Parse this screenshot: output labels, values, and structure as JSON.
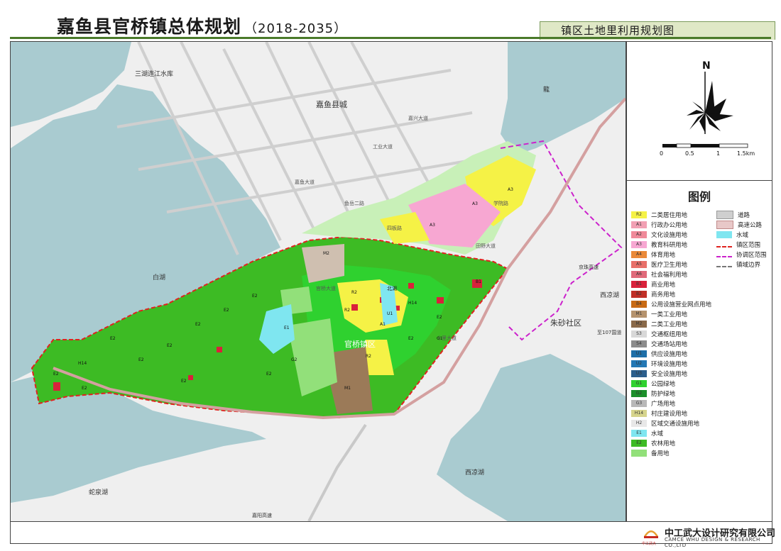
{
  "header": {
    "title": "嘉鱼县官桥镇总体规划",
    "years": "（2018-2035）",
    "subtitle": "镇区土地里利用规划图"
  },
  "colors": {
    "frame_green": "#4a7a2a",
    "water": "#a9cbd0",
    "farmland": "#3dbb24",
    "residential": "#f5f246",
    "education": "#f7a7d2",
    "commercial": "#d9213b",
    "industrial2": "#9b7a58",
    "reserve": "#92e07a",
    "area_boundary": "#e0221f",
    "coord_boundary": "#cc22cc"
  },
  "map": {
    "place_labels": {
      "reservoir": "三湖连江水库",
      "county_town": "嘉鱼县城",
      "bai_lake": "白湖",
      "town_center": "官桥镇区",
      "zhusha": "朱砂社区",
      "xiliang_lake1": "西凉湖",
      "xiliang_lake2": "西凉湖",
      "sheqian_lake": "蛇泉湖",
      "long": "龍",
      "north_lake": "北湖",
      "national_road": "京珠高速",
      "road_107": "至107国道",
      "road_bottom": "嘉阳高速"
    },
    "road_labels": {
      "r1": "嘉鱼大道",
      "r2": "工业大道",
      "r3": "嘉兴大道",
      "r4": "田野大道",
      "r5": "学院路",
      "r6": "官桥大道",
      "r7": "十里大道",
      "r8": "鱼岳二路",
      "r9": "四板路"
    },
    "parcel_codes": [
      "E2",
      "E2",
      "E2",
      "E2",
      "E2",
      "E2",
      "E2",
      "E2",
      "E2",
      "E2",
      "E2",
      "E2",
      "E1",
      "M1",
      "M2",
      "R2",
      "R2",
      "R2",
      "A3",
      "A3",
      "A3",
      "A1",
      "B1",
      "H14",
      "H14",
      "G1",
      "G2",
      "U1"
    ]
  },
  "compass": {
    "north_label": "N",
    "scale_ticks": [
      "0",
      "0.5",
      "1",
      "1.5km"
    ]
  },
  "legend": {
    "title": "图例",
    "left_items": [
      {
        "code": "R2",
        "label": "二类居住用地",
        "color": "#f5f246"
      },
      {
        "code": "A1",
        "label": "行政办公用地",
        "color": "#f2a0b4"
      },
      {
        "code": "A2",
        "label": "文化设施用地",
        "color": "#f08a9a"
      },
      {
        "code": "A3",
        "label": "教育科研用地",
        "color": "#f7a7d2"
      },
      {
        "code": "A4",
        "label": "体育用地",
        "color": "#ea8a3a"
      },
      {
        "code": "A5",
        "label": "医疗卫生用地",
        "color": "#e8706a"
      },
      {
        "code": "A6",
        "label": "社会福利用地",
        "color": "#e06a7a"
      },
      {
        "code": "B1",
        "label": "商业用地",
        "color": "#d9213b"
      },
      {
        "code": "B2",
        "label": "商务用地",
        "color": "#c03028"
      },
      {
        "code": "B4",
        "label": "公用设施营业网点用地",
        "color": "#c86a14"
      },
      {
        "code": "M1",
        "label": "一类工业用地",
        "color": "#b5936e"
      },
      {
        "code": "M2",
        "label": "二类工业用地",
        "color": "#8a6a4a"
      },
      {
        "code": "S3",
        "label": "交通枢纽用地",
        "color": "#d8d8d8"
      },
      {
        "code": "S4",
        "label": "交通场站用地",
        "color": "#8c8c8c"
      },
      {
        "code": "U1",
        "label": "供应设施用地",
        "color": "#1e6fa8"
      },
      {
        "code": "U2",
        "label": "环境设施用地",
        "color": "#2478b4"
      },
      {
        "code": "U3",
        "label": "安全设施用地",
        "color": "#2b5e8c"
      },
      {
        "code": "G1",
        "label": "公园绿地",
        "color": "#2fd12f"
      },
      {
        "code": "G2",
        "label": "防护绿地",
        "color": "#1b8f2a"
      },
      {
        "code": "G3",
        "label": "广场用地",
        "color": "#b8b8b8"
      },
      {
        "code": "H14",
        "label": "村庄建设用地",
        "color": "#d6d48c"
      },
      {
        "code": "H2",
        "label": "区域交通设施用地",
        "color": "#e8e8e8"
      },
      {
        "code": "E1",
        "label": "水域",
        "color": "#7fe6f0"
      },
      {
        "code": "E2",
        "label": "农林用地",
        "color": "#3dbb24"
      },
      {
        "code": "",
        "label": "备用地",
        "color": "#92e07a"
      }
    ],
    "right_items": [
      {
        "label": "道路",
        "kind": "road"
      },
      {
        "label": "高速公路",
        "kind": "expressway"
      },
      {
        "label": "水域",
        "kind": "water"
      },
      {
        "label": "镇区范围",
        "kind": "red-dash"
      },
      {
        "label": "协调区范围",
        "kind": "magenta-dash"
      },
      {
        "label": "镇域边界",
        "kind": "gray-dash"
      }
    ]
  },
  "footer": {
    "company_cn": "中工武大设计研究有限公司",
    "company_en": "CAMCE WHU DESIGN & RESEARCH CO.,LTD",
    "logo_caption": "中工武大"
  }
}
